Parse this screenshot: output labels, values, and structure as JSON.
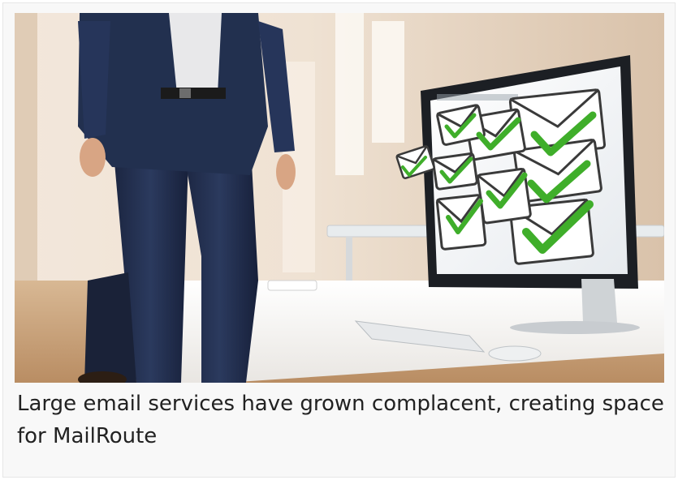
{
  "caption": "Large email services have grown complacent, creating space for MailRoute",
  "image": {
    "subject": "businessman-walking-past-monitor-with-checkmarked-emails",
    "icons": [
      "envelope-icon",
      "checkmark-icon"
    ]
  },
  "colors": {
    "check_green": "#3fae2a",
    "suit_navy": "#1f2a44",
    "wall_warm": "#eadbc9",
    "desk_white": "#f4f2ef"
  }
}
